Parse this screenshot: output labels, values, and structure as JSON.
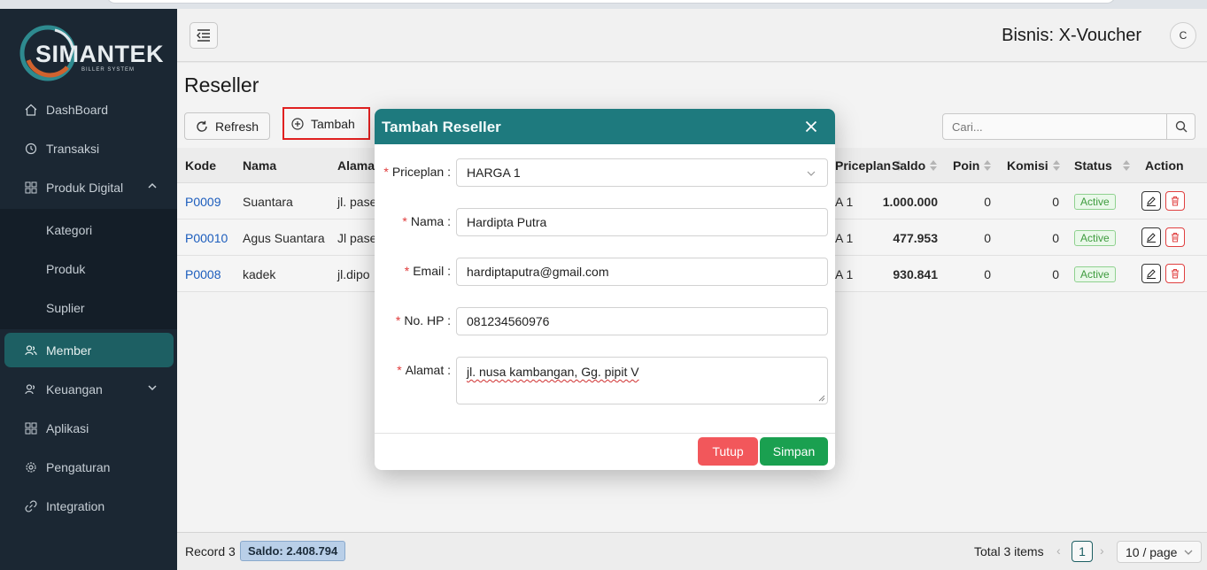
{
  "app": {
    "logo_text": "SIMANTEK",
    "logo_subtext": "BILLER SYSTEM",
    "business_label": "Bisnis: X-Voucher",
    "avatar_initial": "C"
  },
  "sidebar": {
    "items": [
      {
        "label": "DashBoard",
        "icon": "home-icon"
      },
      {
        "label": "Transaksi",
        "icon": "history-icon"
      },
      {
        "label": "Produk Digital",
        "icon": "grid-icon"
      },
      {
        "label": "Kategori"
      },
      {
        "label": "Produk"
      },
      {
        "label": "Suplier"
      },
      {
        "label": "Member",
        "icon": "users-icon"
      },
      {
        "label": "Keuangan",
        "icon": "users-icon"
      },
      {
        "label": "Aplikasi",
        "icon": "grid-icon"
      },
      {
        "label": "Pengaturan",
        "icon": "gear-icon"
      },
      {
        "label": "Integration",
        "icon": "link-icon"
      }
    ]
  },
  "page": {
    "title": "Reseller",
    "refresh_label": "Refresh",
    "tambah_label": "Tambah",
    "search_placeholder": "Cari..."
  },
  "table": {
    "headers": {
      "kode": "Kode",
      "nama": "Nama",
      "alamat": "Alamat",
      "priceplan": "Priceplan",
      "saldo": "Saldo",
      "poin": "Poin",
      "komisi": "Komisi",
      "status": "Status",
      "action": "Action"
    },
    "rows": [
      {
        "kode": "P0009",
        "nama": "Suantara",
        "alamat": "jl. pase",
        "priceplan": "A 1",
        "saldo": "1.000.000",
        "poin": "0",
        "komisi": "0",
        "status": "Active"
      },
      {
        "kode": "P00010",
        "nama": "Agus Suantara",
        "alamat": "Jl pasel",
        "priceplan": "A 1",
        "saldo": "477.953",
        "poin": "0",
        "komisi": "0",
        "status": "Active"
      },
      {
        "kode": "P0008",
        "nama": "kadek",
        "alamat": "jl.dipo",
        "priceplan": "A 1",
        "saldo": "930.841",
        "poin": "0",
        "komisi": "0",
        "status": "Active"
      }
    ]
  },
  "footer": {
    "record_label": "Record 3",
    "saldo_label": "Saldo: 2.408.794",
    "total_items": "Total 3 items",
    "current_page": "1",
    "page_size": "10 / page"
  },
  "modal": {
    "title": "Tambah Reseller",
    "fields": {
      "priceplan": {
        "label": "Priceplan",
        "value": "HARGA 1"
      },
      "nama": {
        "label": "Nama",
        "value": "Hardipta Putra"
      },
      "email": {
        "label": "Email",
        "value": "hardiptaputra@gmail.com"
      },
      "hp": {
        "label": "No. HP",
        "value": "081234560976"
      },
      "alamat": {
        "label": "Alamat",
        "value": "jl. nusa kambangan, Gg. pipit V"
      }
    },
    "tutup_label": "Tutup",
    "simpan_label": "Simpan"
  },
  "colors": {
    "sidebar_bg": "#1b2733",
    "accent": "#1e7a7e",
    "danger": "#f2575b",
    "success": "#1aa050",
    "link": "#1c5dbd"
  }
}
